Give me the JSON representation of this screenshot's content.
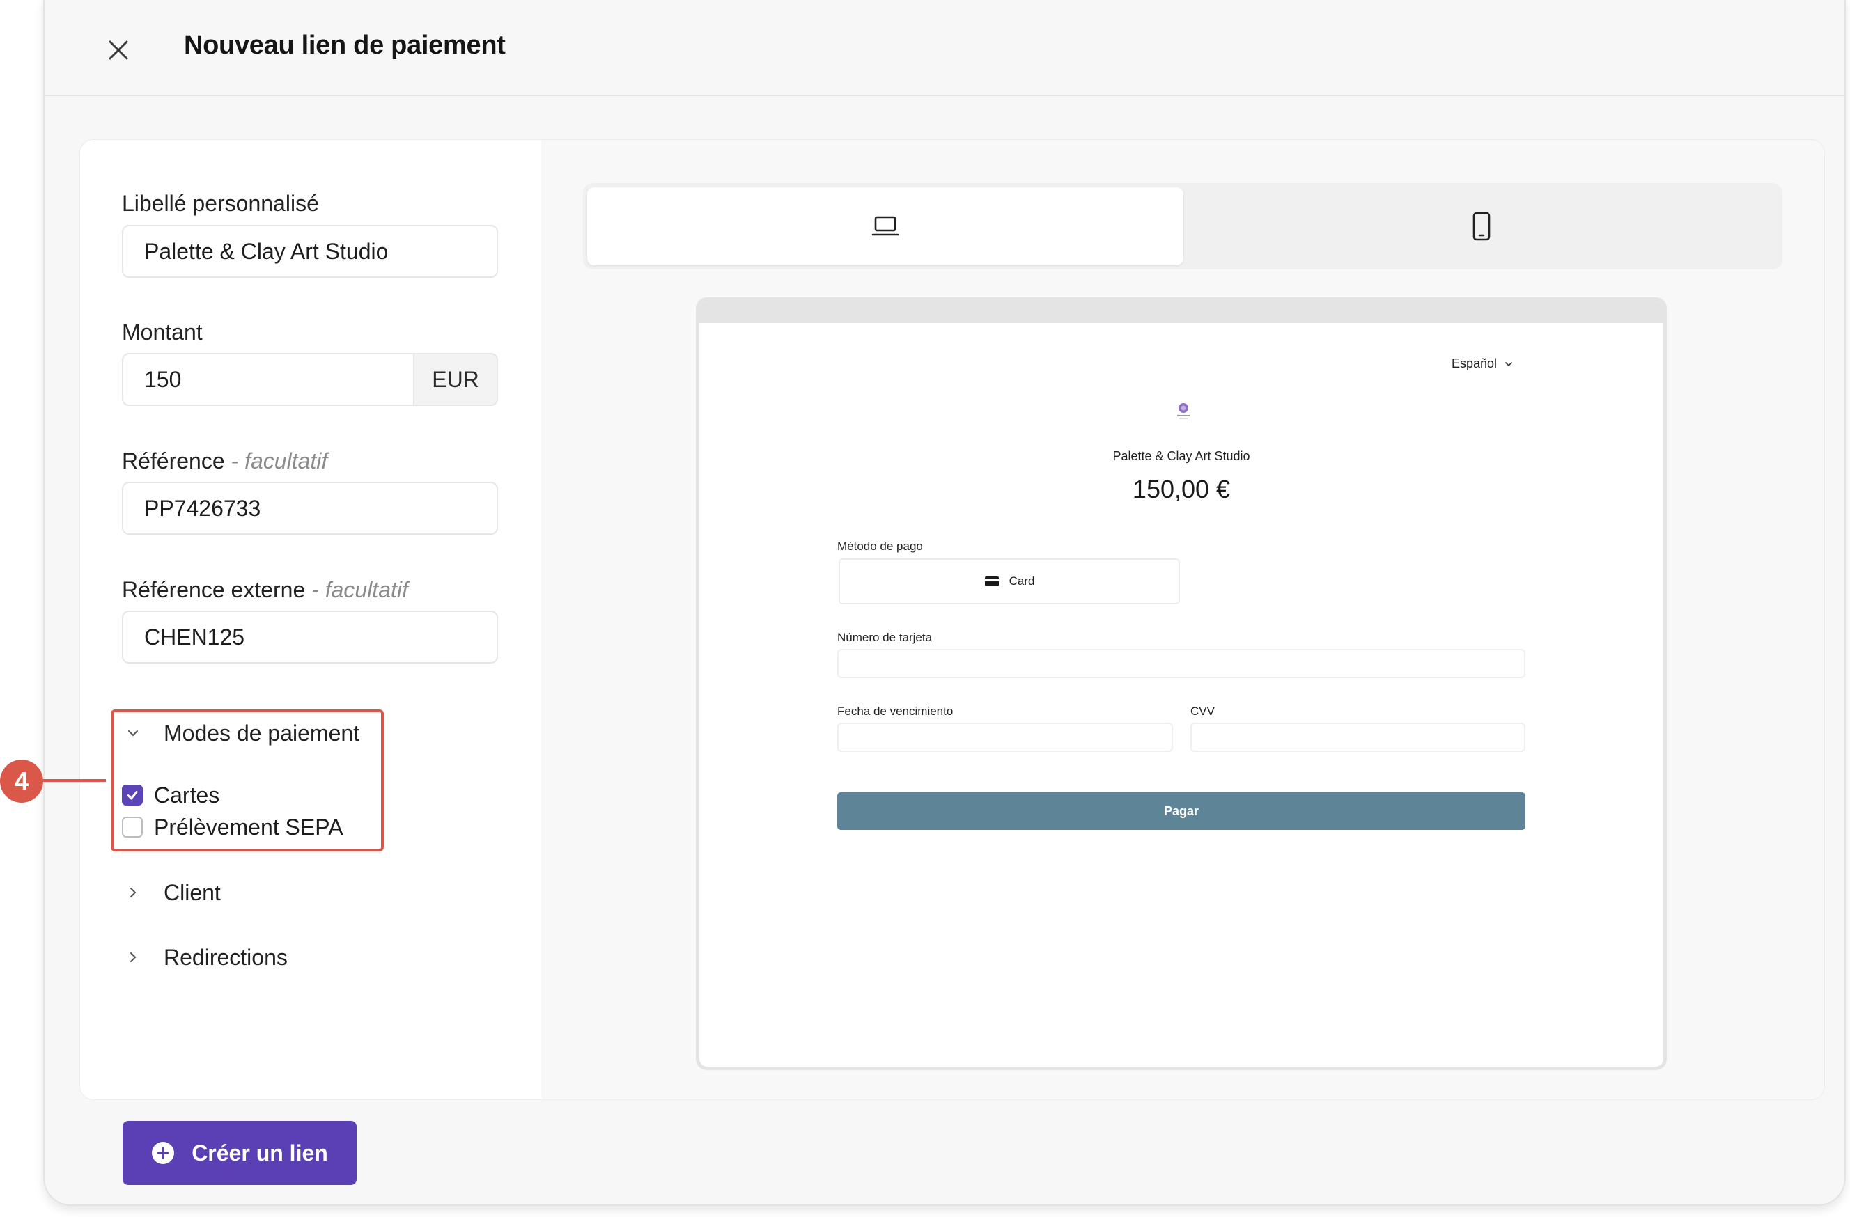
{
  "modal": {
    "title": "Nouveau lien de paiement",
    "close_icon": "close-icon"
  },
  "form": {
    "label": {
      "label": "Libellé personnalisé",
      "value": "Palette & Clay Art Studio"
    },
    "amount": {
      "label": "Montant",
      "value": "150",
      "currency": "EUR"
    },
    "reference": {
      "label": "Référence",
      "optional": " - facultatif",
      "value": "PP7426733"
    },
    "external_reference": {
      "label": "Référence externe",
      "optional": " - facultatif",
      "value": "CHEN125"
    },
    "payment_methods": {
      "label": "Modes de paiement",
      "expanded": true,
      "options": [
        {
          "label": "Cartes",
          "checked": true
        },
        {
          "label": "Prélèvement SEPA",
          "checked": false
        }
      ]
    },
    "client": {
      "label": "Client",
      "expanded": false
    },
    "redirections": {
      "label": "Redirections",
      "expanded": false
    }
  },
  "step_marker": "4",
  "preview": {
    "device_tabs": [
      {
        "icon": "laptop-icon",
        "active": true
      },
      {
        "icon": "mobile-icon",
        "active": false
      }
    ],
    "language": "Español",
    "merchant_name": "Palette & Clay Art Studio",
    "amount": "150,00 €",
    "method_label": "Método de pago",
    "method_button": "Card",
    "card_number_label": "Número de tarjeta",
    "expiry_label": "Fecha de vencimiento",
    "cvv_label": "CVV",
    "pay_button": "Pagar"
  },
  "actions": {
    "create_button": "Créer un lien"
  },
  "colors": {
    "accent": "#5b3fb5",
    "checkbox_checked": "#5b44b8",
    "highlight": "#d9584a",
    "pay_button": "#5e8597"
  }
}
